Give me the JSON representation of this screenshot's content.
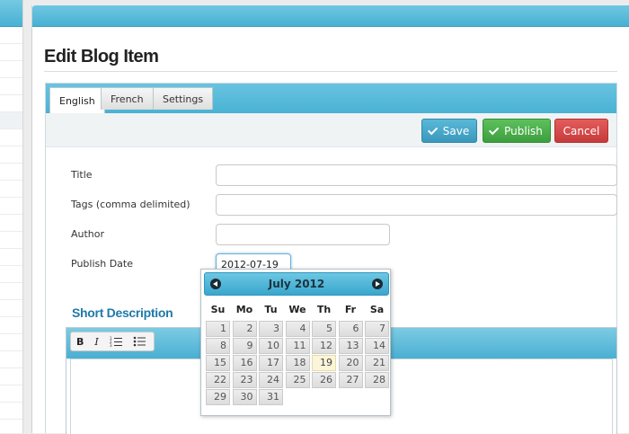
{
  "page": {
    "title": "Edit Blog Item"
  },
  "tabs": [
    {
      "label": "English",
      "active": true
    },
    {
      "label": "French",
      "active": false
    },
    {
      "label": "Settings",
      "active": false
    }
  ],
  "toolbar": {
    "save_label": "Save",
    "publish_label": "Publish",
    "cancel_label": "Cancel"
  },
  "form": {
    "title_label": "Title",
    "tags_label": "Tags (comma delimited)",
    "author_label": "Author",
    "publish_date_label": "Publish Date",
    "publish_date_value": "2012-07-19",
    "title_value": "",
    "tags_value": "",
    "author_value": ""
  },
  "short_description": {
    "heading": "Short Description",
    "bold_label": "B",
    "italic_label": "I"
  },
  "datepicker": {
    "month_label": "July 2012",
    "weekdays": [
      "Su",
      "Mo",
      "Tu",
      "We",
      "Th",
      "Fr",
      "Sa"
    ],
    "days": [
      "1",
      "2",
      "3",
      "4",
      "5",
      "6",
      "7",
      "8",
      "9",
      "10",
      "11",
      "12",
      "13",
      "14",
      "15",
      "16",
      "17",
      "18",
      "19",
      "20",
      "21",
      "22",
      "23",
      "24",
      "25",
      "26",
      "27",
      "28",
      "29",
      "30",
      "31"
    ],
    "first_weekday_index": 0,
    "selected_day": "19"
  },
  "colors": {
    "accent": "#4ab2d4",
    "save": "#3a98bc",
    "publish": "#3d9e3d",
    "cancel": "#c73b3b",
    "heading": "#1f7aa8"
  }
}
